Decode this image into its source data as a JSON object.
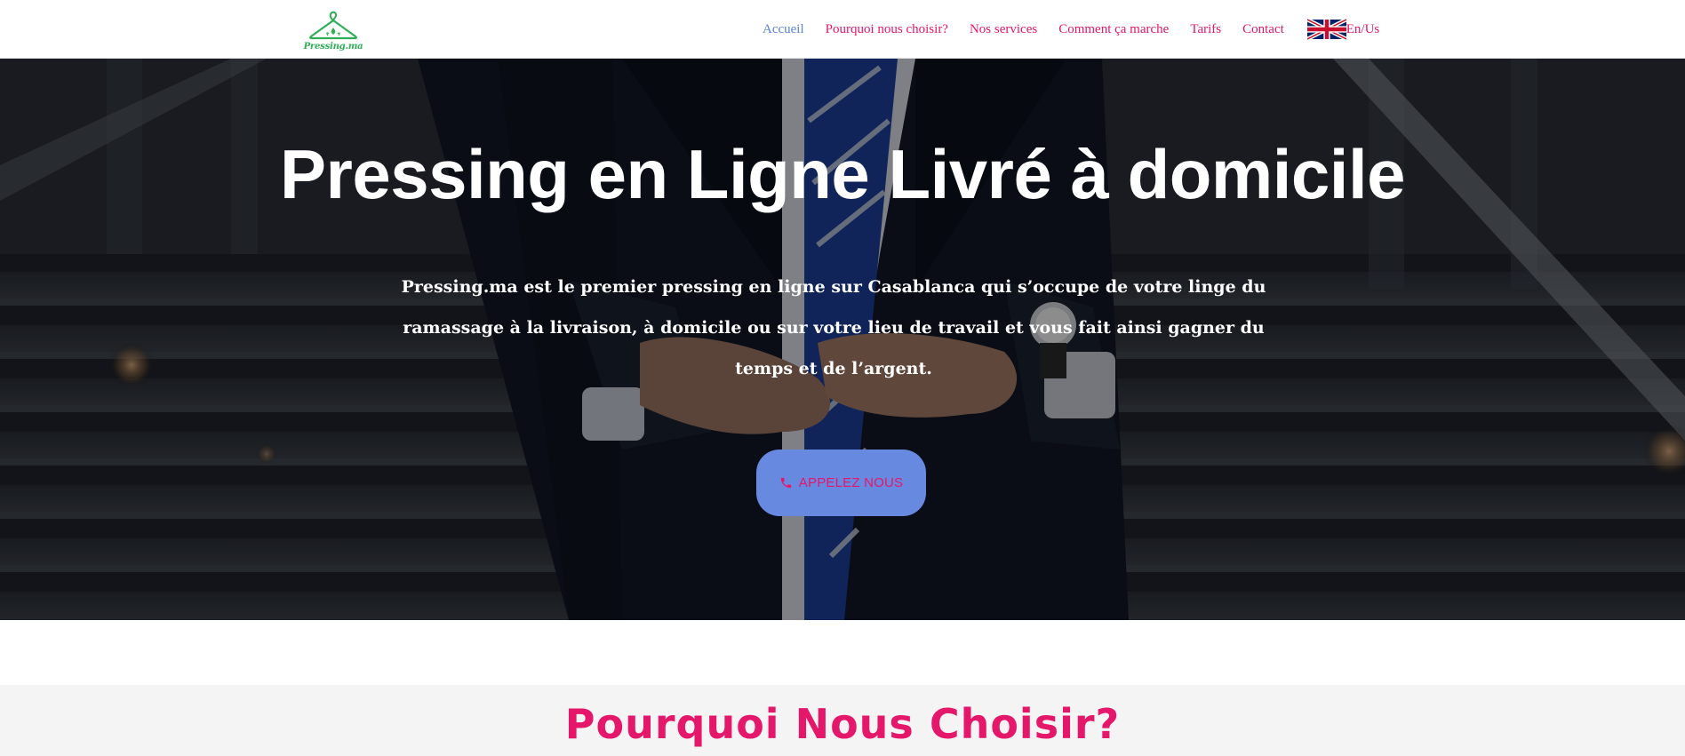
{
  "header": {
    "logo_text": "Pressing.ma",
    "nav": [
      {
        "label": "Accueil",
        "active": true
      },
      {
        "label": "Pourquoi nous choisir?",
        "active": false
      },
      {
        "label": "Nos services",
        "active": false
      },
      {
        "label": "Comment ça marche",
        "active": false
      },
      {
        "label": "Tarifs",
        "active": false
      },
      {
        "label": "Contact",
        "active": false
      }
    ],
    "language_label": "En/Us",
    "language_icon": "uk-flag-icon"
  },
  "hero": {
    "title": "Pressing en Ligne Livré à domicile",
    "description": "Pressing.ma est le premier pressing en ligne sur Casablanca qui s’occupe de votre linge du ramassage à la livraison, à domicile ou sur votre lieu de travail et vous fait ainsi gagner du temps et de l’argent.",
    "cta_label": "APPELEZ NOUS",
    "cta_icon": "phone-icon"
  },
  "section": {
    "title": "Pourquoi Nous Choisir?"
  },
  "colors": {
    "brand_pink": "#e5176b",
    "accent_blue": "#5b82d8",
    "button_blue": "#6789e0",
    "logo_green": "#2fae57"
  }
}
